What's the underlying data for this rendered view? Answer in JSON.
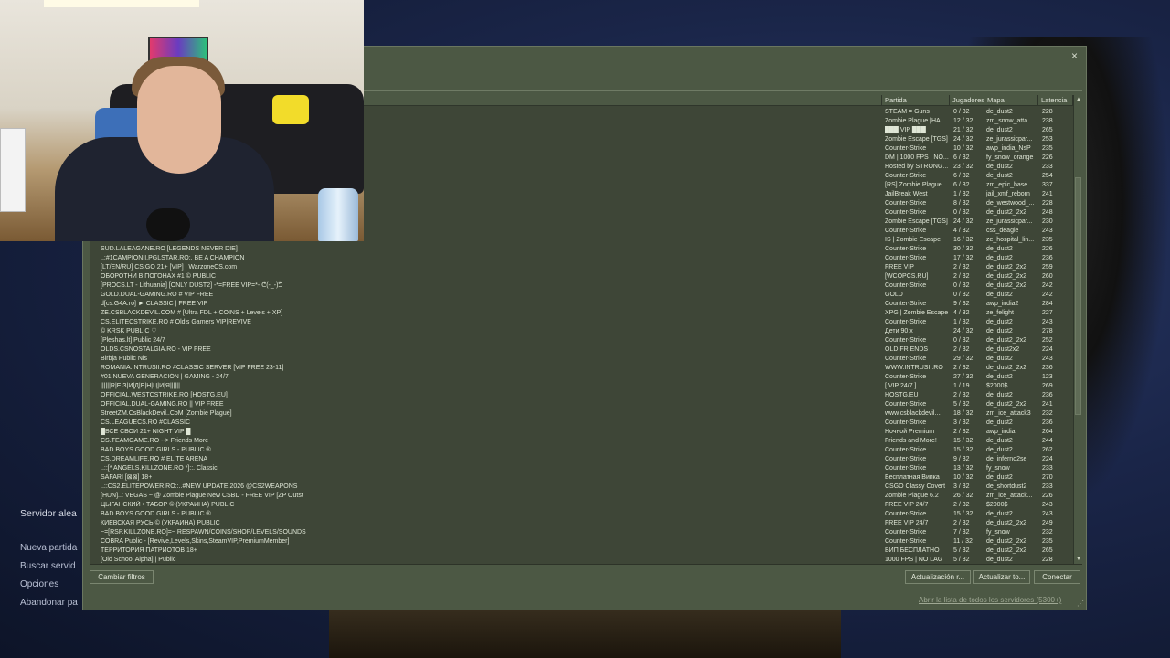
{
  "background": {
    "side_menu_title": "Servidor alea",
    "side_menu_items": [
      "Nueva partida",
      "Buscar servid",
      "Opciones",
      "Abandonar pa"
    ]
  },
  "dialog": {
    "close_glyph": "×",
    "columns": {
      "game": "Partida",
      "players": "Jugadores",
      "map": "Mapa",
      "latency": "Latencia"
    },
    "right_rows": [
      [
        "STEAM = Guns",
        "0 / 32",
        "de_dust2",
        "228"
      ],
      [
        "Zombie Plague [HA...",
        "12 / 32",
        "zm_snow_atta...",
        "238"
      ],
      [
        "███ VIP ███",
        "21 / 32",
        "de_dust2",
        "265"
      ],
      [
        "Zombie Escape [TGS]",
        "24 / 32",
        "ze_jurassicpar...",
        "253"
      ],
      [
        "Counter-Strike",
        "10 / 32",
        "awp_india_NsP",
        "235"
      ],
      [
        "DM | 1000 FPS | NO...",
        "6 / 32",
        "fy_snow_orange",
        "226"
      ],
      [
        "Hosted by STRONG...",
        "23 / 32",
        "de_dust2",
        "233"
      ],
      [
        "Counter-Strike",
        "6 / 32",
        "de_dust2",
        "254"
      ],
      [
        "[RS] Zombie Plague",
        "6 / 32",
        "zm_epic_base",
        "337"
      ],
      [
        "JailBreak West",
        "1 / 32",
        "jail_xmf_reborn",
        "241"
      ],
      [
        "Counter-Strike",
        "8 / 32",
        "de_westwood_...",
        "228"
      ],
      [
        "Counter-Strike",
        "0 / 32",
        "de_dust2_2x2",
        "248"
      ],
      [
        "Zombie Escape [TGS]",
        "24 / 32",
        "ze_jurassicpar...",
        "230"
      ],
      [
        "Counter-Strike",
        "4 / 32",
        "css_deagle",
        "243"
      ],
      [
        "IS | Zombie Escape",
        "16 / 32",
        "ze_hospital_lin...",
        "235"
      ],
      [
        "Counter-Strike",
        "30 / 32",
        "de_dust2",
        "226"
      ],
      [
        "Counter-Strike",
        "17 / 32",
        "de_dust2",
        "236"
      ],
      [
        "FREE VIP",
        "2 / 32",
        "de_dust2_2x2",
        "259"
      ],
      [
        "[WCOPCS.RU]",
        "2 / 32",
        "de_dust2_2x2",
        "260"
      ],
      [
        "Counter-Strike",
        "0 / 32",
        "de_dust2_2x2",
        "242"
      ],
      [
        "GOLD",
        "0 / 32",
        "de_dust2",
        "242"
      ],
      [
        "Counter-Strike",
        "9 / 32",
        "awp_india2",
        "284"
      ],
      [
        "XPG | Zombie Escape",
        "4 / 32",
        "ze_felight",
        "227"
      ],
      [
        "Counter-Strike",
        "1 / 32",
        "de_dust2",
        "243"
      ],
      [
        "Дети 90 х",
        "24 / 32",
        "de_dust2",
        "278"
      ],
      [
        "Counter-Strike",
        "0 / 32",
        "de_dust2_2x2",
        "252"
      ],
      [
        "OLD FRIENDS",
        "2 / 32",
        "de_dust2x2",
        "224"
      ],
      [
        "Counter-Strike",
        "29 / 32",
        "de_dust2",
        "243"
      ],
      [
        "WWW.INTRUSII.RO",
        "2 / 32",
        "de_dust2_2x2",
        "236"
      ],
      [
        "Counter-Strike",
        "27 / 32",
        "de_dust2",
        "123"
      ],
      [
        "[ VIP 24/7 ]",
        "1 / 19",
        "$2000$",
        "269"
      ],
      [
        "HOSTG.EU",
        "2 / 32",
        "de_dust2",
        "236"
      ],
      [
        "Counter-Strike",
        "5 / 32",
        "de_dust2_2x2",
        "241"
      ],
      [
        "www.csblackdevil....",
        "18 / 32",
        "zm_ice_attack3",
        "232"
      ],
      [
        "Counter-Strike",
        "3 / 32",
        "de_dust2",
        "236"
      ],
      [
        "Ночной Premium",
        "2 / 32",
        "awp_india",
        "264"
      ],
      [
        "Friends and More!",
        "15 / 32",
        "de_dust2",
        "244"
      ],
      [
        "Counter-Strike",
        "15 / 32",
        "de_dust2",
        "262"
      ],
      [
        "Counter-Strike",
        "9 / 32",
        "de_inferno2se",
        "224"
      ],
      [
        "Counter-Strike",
        "13 / 32",
        "fy_snow",
        "233"
      ],
      [
        "Бесплатная Випка",
        "10 / 32",
        "de_dust2",
        "270"
      ],
      [
        "CSGO Classy Covert",
        "3 / 32",
        "de_shortdust2",
        "233"
      ],
      [
        "Zombie Plague 6.2",
        "26 / 32",
        "zm_ice_attack...",
        "226"
      ],
      [
        "FREE VIP 24/7",
        "2 / 32",
        "$2000$",
        "243"
      ],
      [
        "Counter-Strike",
        "15 / 32",
        "de_dust2",
        "243"
      ],
      [
        "FREE VIP 24/7",
        "2 / 32",
        "de_dust2_2x2",
        "249"
      ],
      [
        "Counter-Strike",
        "7 / 32",
        "fy_snow",
        "232"
      ],
      [
        "Counter-Strike",
        "11 / 32",
        "de_dust2_2x2",
        "235"
      ],
      [
        "ВИП БЕСПЛАТНО",
        "5 / 32",
        "de_dust2_2x2",
        "265"
      ],
      [
        "1000 FPS | NO LAG",
        "5 / 32",
        "de_dust2",
        "228"
      ]
    ],
    "left_rows": [
      "SUD.LALEAGANE.RO [LEGENDS NEVER DIE]",
      "..:#1CAMPIONII.PGLSTAR.RO:. BE A CHAMPION",
      "[LT/EN/RU] CS:GO 21+ [VIP] | WarzoneCS.com",
      "ОБОРОТНИ В ПОГОНАХ #1 © PUBLIC",
      "[PROCS.LT - Lithuania] [ONLY DUST2] -*=FREE VIP=*- ᕦ(-_-)ᕤ",
      "GOLD.DUAL-GAMING.RO # VIP FREE",
      "d[cs.G4A.ro] ► CLASSIC | FREE VIP",
      "ZE.CSBLACKDEVIL.COM # [Ultra FDL + COINS + Levels + XP]",
      "CS.ELITECSTRIKE.RO # Old's Gamers VIP|REVIVE",
      "© KRSK PUBLIC ♡",
      "[Pleshas.lt] Public 24/7",
      "OLDS.CSNOSTALGIA.RO - VIP FREE",
      "Birbja Public Nis",
      "ROMANIA.INTRUSII.RO #CLASSIC SERVER [VIP FREE 23-11]",
      "#01 NUEVA GENERACIÓN | GAMING - 24/7",
      "||||||R|E|З|И|Д|Е|Н|Ц|И|Я||||||",
      "OFFICIAL.WESTCSTRIKE.RO [HOSTG.EU]",
      "OFFICIAL.DUAL-GAMING.RO || VIP FREE",
      "StreetZM.CsBlackDevil..CoM [Zombie Plague]",
      "CS.LEAGUECS.RO #CLASSIC",
      "█ВСЕ СВОИ 21+ NIGHT VIP █",
      "CS.TEAMGAME.RO --> Friends  More",
      "BAD BOYS  GOOD GIRLS - PUBLIC ®",
      "CS.DREAMLIFE.RO # ELITE ARENA",
      "..::[* ANGELS.KILLZONE.RO *]::. Classic",
      "SAFARI [⊠⊠] 18+",
      "..::CS2.ELITEPOWER.RO::..#NEW UPDATE 2026 @CS2WEAPONS",
      "[HUN]..: VEGAS ~ @ Zombie Plague  New CSBD - FREE VIP [ZP Outst",
      "ЦЫГАНСКИЙ • ТАБОР © (УКРАИНА) PUBLIC",
      "BAD BOYS  GOOD GIRLS - PUBLIC ®",
      "КИЕВСКАЯ РУСЬ © (УКРАИНА) PUBLIC",
      "~=[RSP.KILLZONE.RO]=~ RESPAWN/COINS/SHOP/LEVELS/SOUNDS",
      "COBRA Public - [Revive,Levels,Skins,SteamVIP,PremiumMember]",
      "ТЕРРИТОРИЯ ПАТРИОТОВ 18+",
      "[Old School Alpha] | Public"
    ],
    "buttons": {
      "change_filters": "Cambiar filtros",
      "refresh_q": "Actualización r...",
      "refresh_all": "Actualizar to...",
      "connect": "Conectar"
    },
    "footer_link": "Abrir la lista de todos los servidores (5300+)"
  }
}
